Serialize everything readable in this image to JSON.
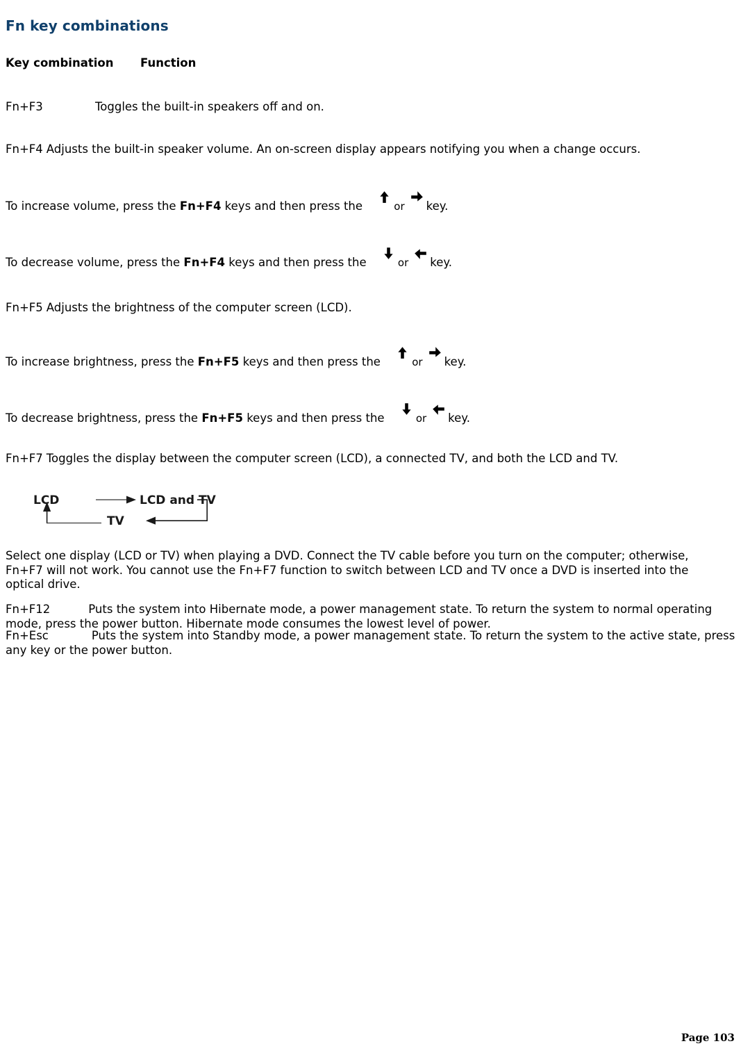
{
  "document": {
    "heading": "Fn key combinations",
    "heading_color": "#10406b",
    "table_headers": {
      "key_combination": "Key combination",
      "function": "Function"
    },
    "rows": [
      {
        "key": "Fn+F3",
        "text": "Toggles the built-in speakers off and on."
      },
      {
        "key": "Fn+F4",
        "text": "Adjusts the built-in speaker volume. An on-screen display appears notifying you when a change occurs."
      },
      {
        "key": "Fn+F5",
        "text": "Adjusts the brightness of the computer screen (LCD)."
      },
      {
        "key": "Fn+F7",
        "text": "Toggles the display between the computer screen (LCD), a connected TV, and both the LCD and TV."
      }
    ],
    "instructions": [
      {
        "lead": "To increase volume, press the ",
        "keys": "Fn+F4",
        "mid": " keys and then press the ",
        "icon_a": "arrow-up-icon",
        "or": "or",
        "icon_b": "arrow-right-icon",
        "tail": "key."
      },
      {
        "lead": "To decrease volume, press the ",
        "keys": "Fn+F4",
        "mid": " keys and then press the ",
        "icon_a": "arrow-down-icon",
        "or": "or",
        "icon_b": "arrow-left-icon",
        "tail": "key."
      },
      {
        "lead": "To increase brightness, press the ",
        "keys": "Fn+F5",
        "mid": " keys and then press the ",
        "icon_a": "arrow-up-icon",
        "or": "or",
        "icon_b": "arrow-right-icon",
        "tail": "key."
      },
      {
        "lead": "To decrease brightness, press the ",
        "keys": "Fn+F5",
        "mid": " keys and then press the ",
        "icon_a": "arrow-down-icon",
        "or": "or",
        "icon_b": "arrow-left-icon",
        "tail": "key."
      }
    ],
    "diagram": {
      "name": "display-toggle-cycle-diagram",
      "nodes": [
        "LCD",
        "LCD and TV",
        "TV"
      ],
      "cycle": "LCD -> LCD and TV -> TV -> LCD"
    },
    "notes": [
      "Select one display (LCD or TV) when playing a DVD. Connect the TV cable before you turn on the computer; otherwise, Fn+F7 will not work. You cannot use the Fn+F7 function to switch between LCD and TV once a DVD is inserted into the optical drive.",
      "Fn+F12  Puts the system into Hibernate mode, a power management state. To return the system to normal operating mode, press the power button. Hibernate mode consumes the lowest level of power.",
      "Fn+Esc  Puts the system into Standby mode, a power management state. To return the system to the active state, press any key or the power button."
    ],
    "power_rows": [
      {
        "key": "Fn+F12",
        "text": "Puts the system into Hibernate mode, a power management state. To return the system to normal operating mode, press the power button. Hibernate mode consumes the lowest level of power."
      },
      {
        "key": "Fn+Esc",
        "text": "Puts the system into Standby mode, a power management state. To return the system to the active state, press any key or the power button."
      }
    ],
    "footer": "Page 103"
  }
}
